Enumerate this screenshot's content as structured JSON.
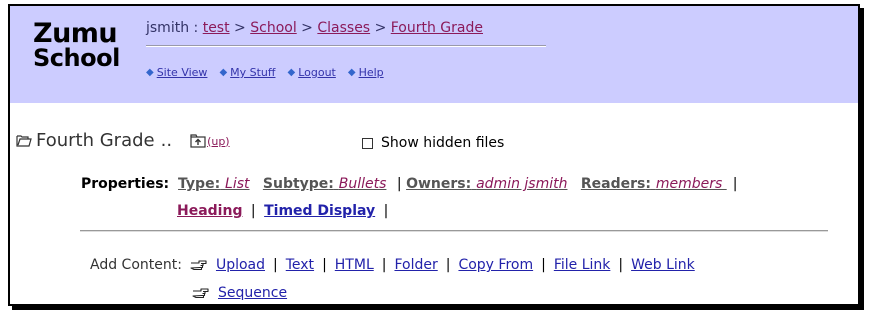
{
  "header": {
    "logo_line1": "Zumu",
    "logo_line2": "School",
    "breadcrumb": {
      "user": "jsmith",
      "separator": ":",
      "items": [
        "test",
        "School",
        "Classes",
        "Fourth Grade"
      ],
      "arrow": ">"
    },
    "nav": [
      "Site View",
      "My Stuff",
      "Logout",
      "Help"
    ]
  },
  "folder": {
    "title": "Fourth Grade",
    "dots": "..",
    "up_label": "(up)",
    "show_hidden_label": "Show hidden files",
    "show_hidden_checked": false
  },
  "properties": {
    "label": "Properties:",
    "type": {
      "key": "Type",
      "value": "List"
    },
    "subtype": {
      "key": "Subtype",
      "value": "Bullets"
    },
    "owners": {
      "key": "Owners",
      "value": "admin jsmith"
    },
    "readers": {
      "key": "Readers",
      "value": "members "
    },
    "heading": "Heading",
    "timed_display": "Timed Display",
    "pipe": "|",
    "colon": ":"
  },
  "add_content": {
    "label": "Add Content:",
    "items": [
      "Upload",
      "Text",
      "HTML",
      "Folder",
      "Copy From",
      "File Link",
      "Web Link"
    ],
    "items_row2": [
      "Sequence"
    ],
    "pipe": "|"
  },
  "colors": {
    "header_bg": "#ccccff",
    "link_visited": "#8b1a5a",
    "link": "#2222aa"
  },
  "icons": {
    "folder": "open-folder-icon",
    "up": "up-folder-icon",
    "hand": "pointing-hand-icon",
    "nav_bullet": "diamond-bullet-icon"
  }
}
